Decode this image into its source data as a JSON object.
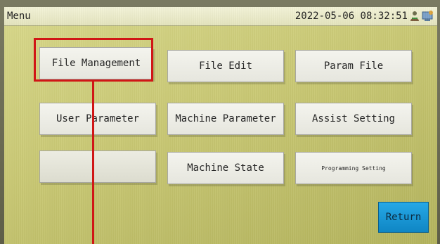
{
  "titlebar": {
    "title": "Menu",
    "datetime": "2022-05-06 08:32:51",
    "icons": [
      "person-icon",
      "network-icon"
    ]
  },
  "buttons": {
    "file_management": "File Management",
    "file_edit": "File Edit",
    "param_file": "Param File",
    "user_parameter": "User Parameter",
    "machine_parameter": "Machine Parameter",
    "assist_setting": "Assist Setting",
    "blank": "",
    "machine_state": "Machine State",
    "programming_setting": "Programming Setting",
    "return": "Return"
  },
  "colors": {
    "highlight": "#d01616",
    "screen_background": "#c9c873",
    "return_button": "#1a98d8"
  }
}
